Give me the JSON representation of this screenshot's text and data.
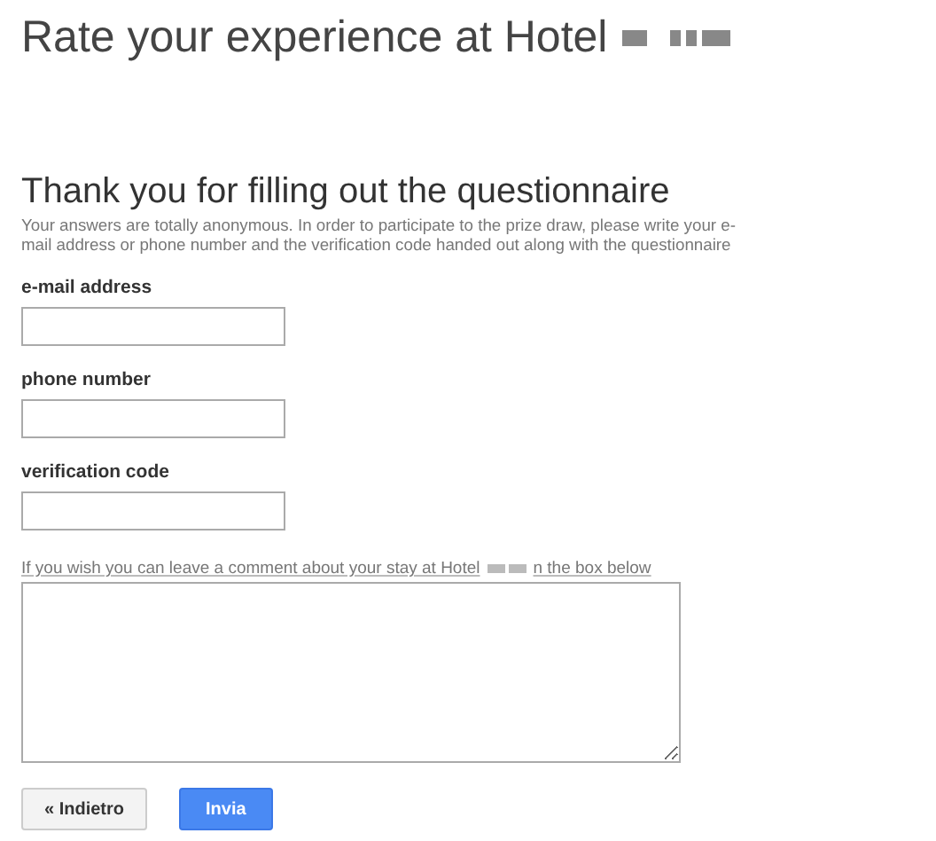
{
  "page_title": "Rate your experience at Hotel",
  "heading": "Thank you for filling out the questionnaire",
  "description_lines": [
    "Your answers are totally anonymous. In order to participate to the prize draw, please write your e-",
    "mail address or phone number and the verification code handed out along with the questionnaire"
  ],
  "fields": [
    {
      "label": "e-mail address"
    },
    {
      "label": "phone number"
    },
    {
      "label": "verification code"
    }
  ],
  "comment": {
    "label_before": "If you wish you can leave a comment about your stay at Hotel",
    "label_after": "n the box below"
  },
  "buttons": [
    {
      "kind": "secondary",
      "label": "« Indietro"
    },
    {
      "kind": "primary",
      "label": "Invia"
    }
  ]
}
